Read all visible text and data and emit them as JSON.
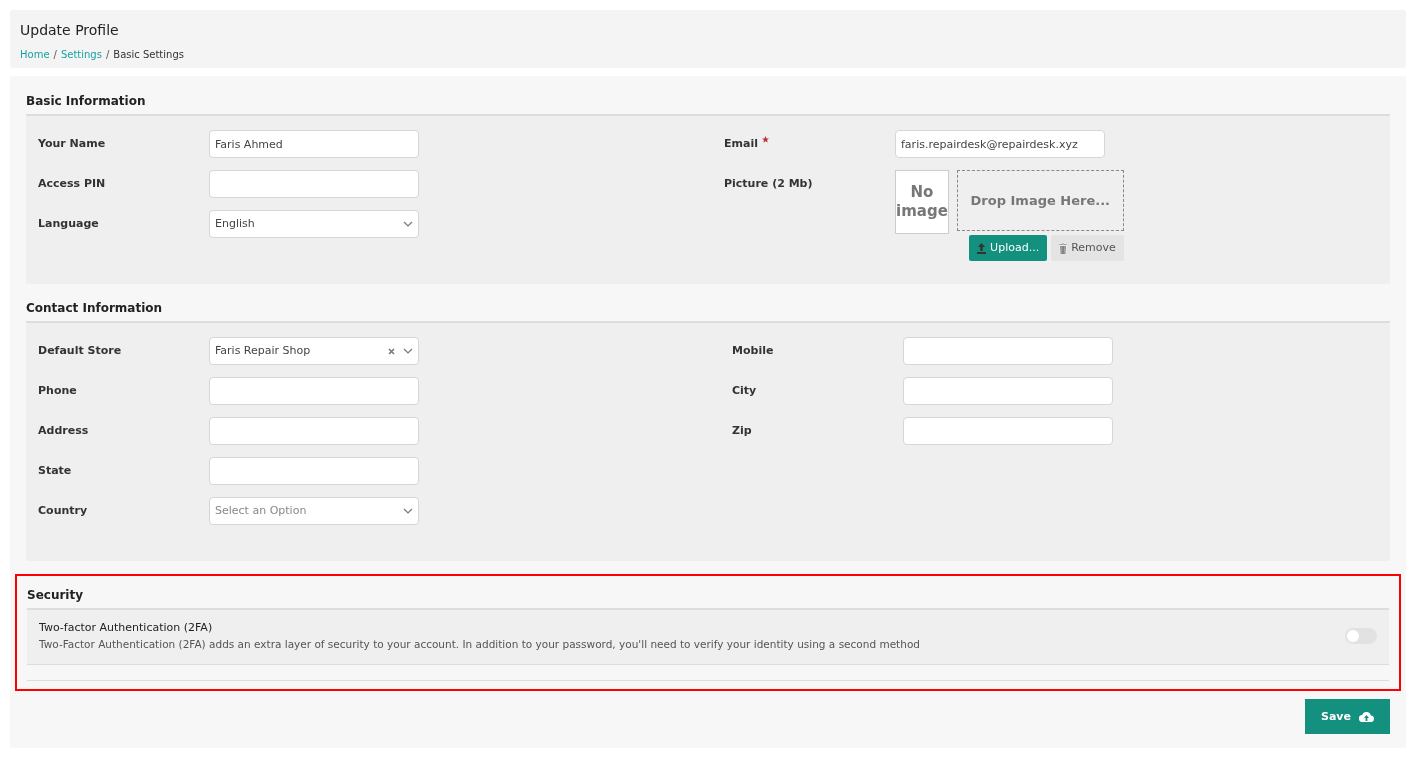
{
  "header": {
    "title": "Update Profile",
    "separator": "/",
    "breadcrumb": [
      {
        "label": "Home",
        "link": true
      },
      {
        "label": "Settings",
        "link": true
      },
      {
        "label": "Basic Settings",
        "link": false
      }
    ]
  },
  "sections": [
    {
      "title": "Basic Information",
      "columns": [
        [
          {
            "label": "Your Name",
            "kind": "text",
            "value": "Faris Ahmed"
          },
          {
            "label": "Access PIN",
            "kind": "text"
          },
          {
            "label": "Language",
            "kind": "select",
            "value": "English"
          }
        ],
        [
          {
            "label": "Email",
            "kind": "text",
            "required": true,
            "value": "faris.repairdesk@repairdesk.xyz"
          },
          {
            "label": "Picture (2 Mb)",
            "kind": "picture",
            "preview": "No image",
            "dropzone": "Drop Image Here...",
            "upload": "Upload...",
            "remove": "Remove"
          }
        ]
      ]
    },
    {
      "title": "Contact Information",
      "columns": [
        [
          {
            "label": "Default Store",
            "kind": "select",
            "value": "Faris Repair Shop",
            "clearable": true
          },
          {
            "label": "Phone",
            "kind": "text"
          },
          {
            "label": "Address",
            "kind": "text"
          },
          {
            "label": "State",
            "kind": "text"
          },
          {
            "label": "Country",
            "kind": "select",
            "placeholder": "Select an Option"
          }
        ],
        [
          {
            "label": "Mobile",
            "kind": "text"
          },
          {
            "label": "City",
            "kind": "text"
          },
          {
            "label": "Zip",
            "kind": "text"
          }
        ]
      ]
    }
  ],
  "security": {
    "title": "Security",
    "highlighted": true,
    "items": [
      {
        "title": "Two-factor Authentication (2FA)",
        "description": "Two-Factor Authentication (2FA) adds an extra layer of security to your account. In addition to your password, you'll need to verify your identity using a second method",
        "on": false
      }
    ]
  },
  "save_button": "Save"
}
